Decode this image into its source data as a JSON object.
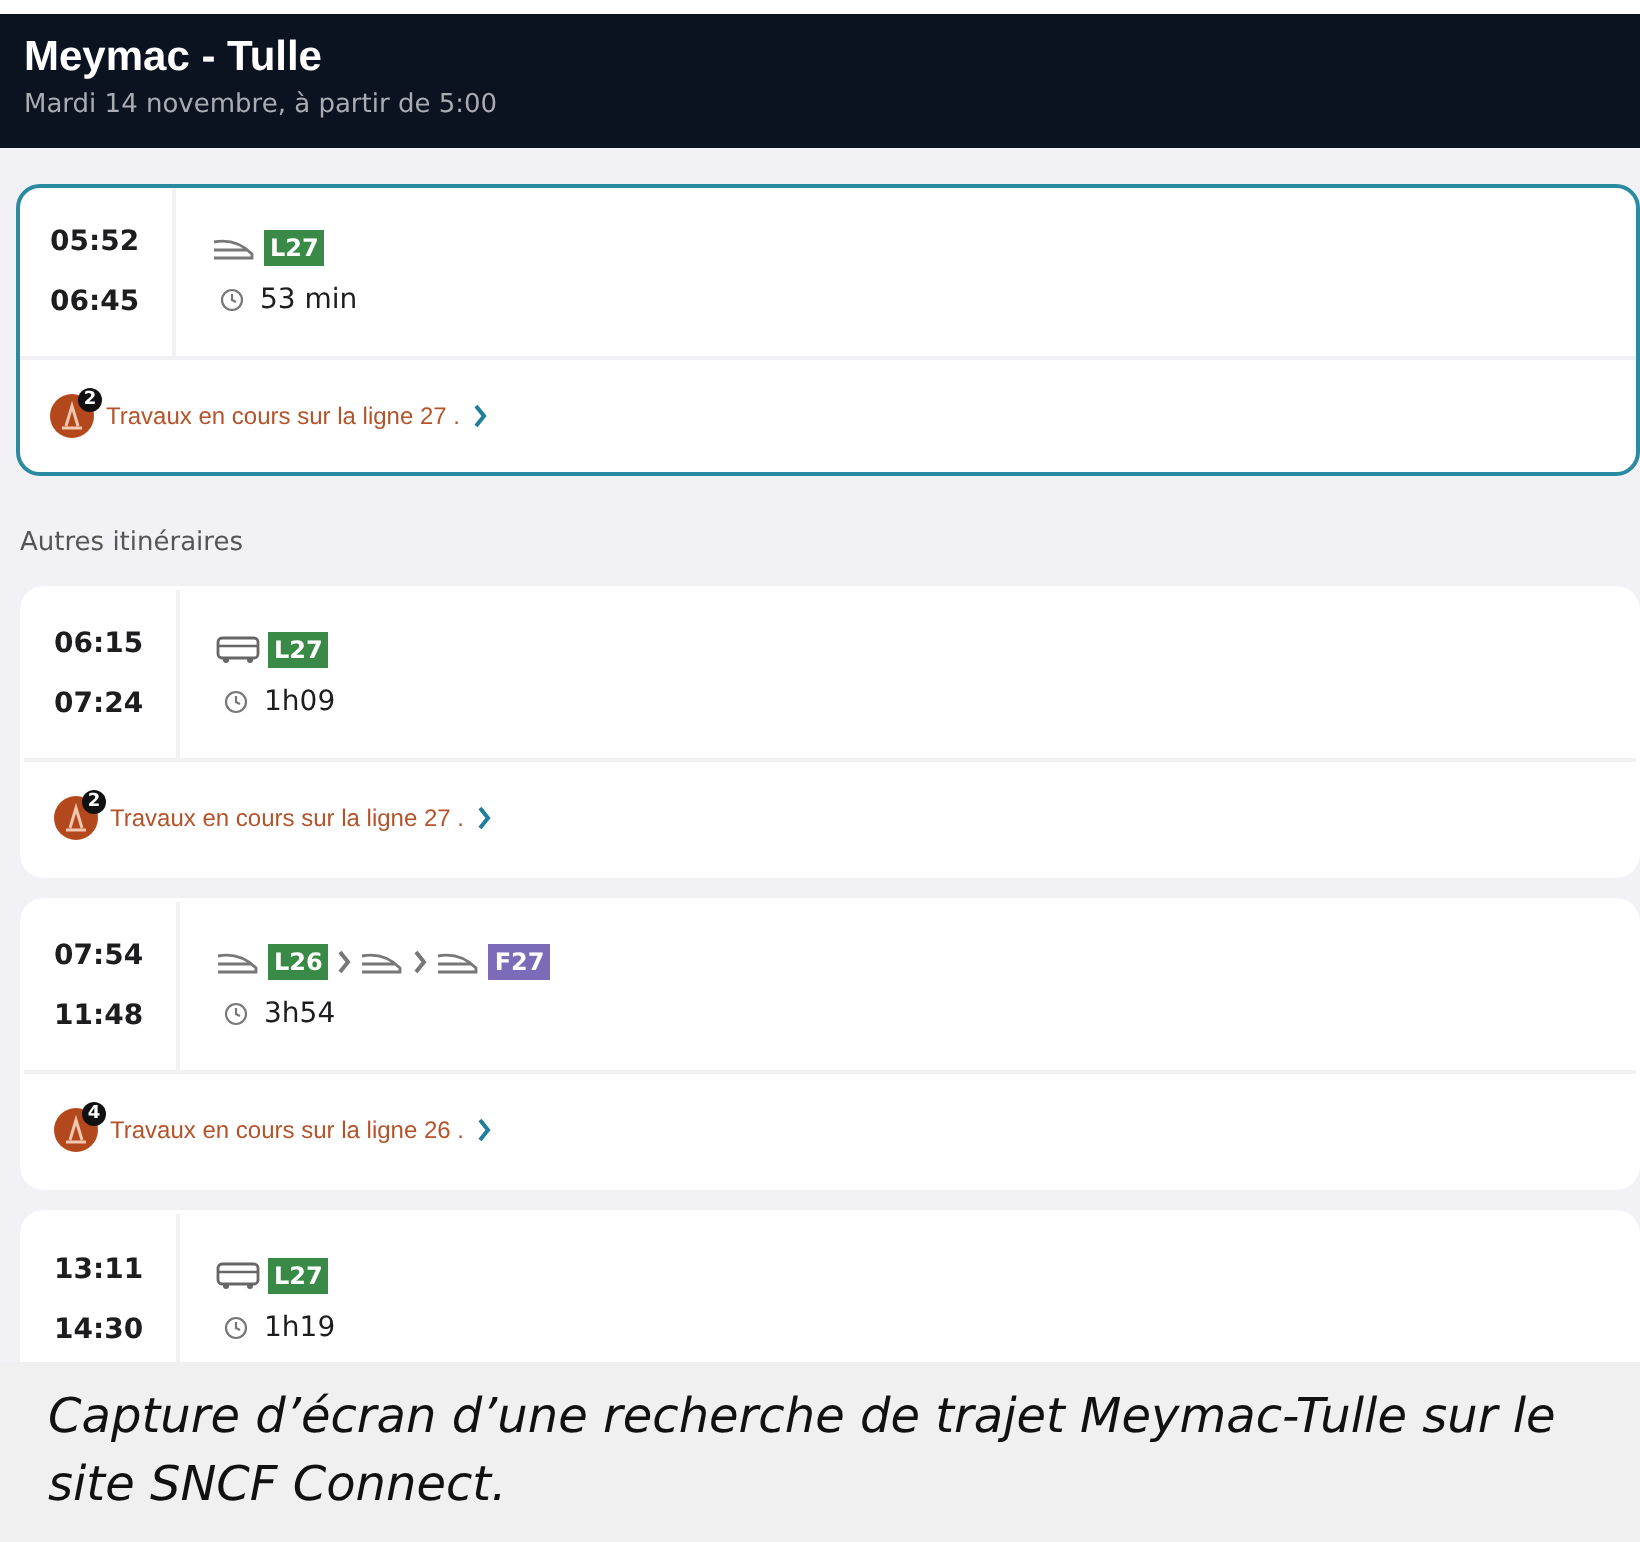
{
  "header": {
    "title": "Meymac - Tulle",
    "subtitle": "Mardi 14 novembre, à partir de 5:00"
  },
  "best": {
    "departure": "05:52",
    "arrival": "06:45",
    "selected": true,
    "legs": [
      {
        "kind": "train",
        "line": "L27",
        "color": "#3a8a47"
      }
    ],
    "duration": "53 min",
    "alert": {
      "count": "2",
      "text": "Travaux en cours sur la ligne 27 ."
    }
  },
  "section_title": "Autres itinéraires",
  "journeys": [
    {
      "departure": "06:15",
      "arrival": "07:24",
      "selected": false,
      "legs": [
        {
          "kind": "bus",
          "line": "L27",
          "color": "#3a8a47"
        }
      ],
      "duration": "1h09",
      "alert": {
        "count": "2",
        "text": "Travaux en cours sur la ligne 27 ."
      }
    },
    {
      "departure": "07:54",
      "arrival": "11:48",
      "selected": false,
      "legs": [
        {
          "kind": "train",
          "line": "L26",
          "color": "#3a8a47"
        },
        {
          "kind": "train"
        },
        {
          "kind": "train",
          "line": "F27",
          "color": "#7b6bb8"
        }
      ],
      "duration": "3h54",
      "alert": {
        "count": "4",
        "text": "Travaux en cours sur la ligne 26 ."
      }
    },
    {
      "departure": "13:11",
      "arrival": "14:30",
      "selected": false,
      "legs": [
        {
          "kind": "bus",
          "line": "L27",
          "color": "#3a8a47"
        }
      ],
      "duration": "1h19"
    }
  ],
  "caption": "Capture d’écran d’une recherche de trajet Meymac-Tulle sur le site SNCF Connect."
}
